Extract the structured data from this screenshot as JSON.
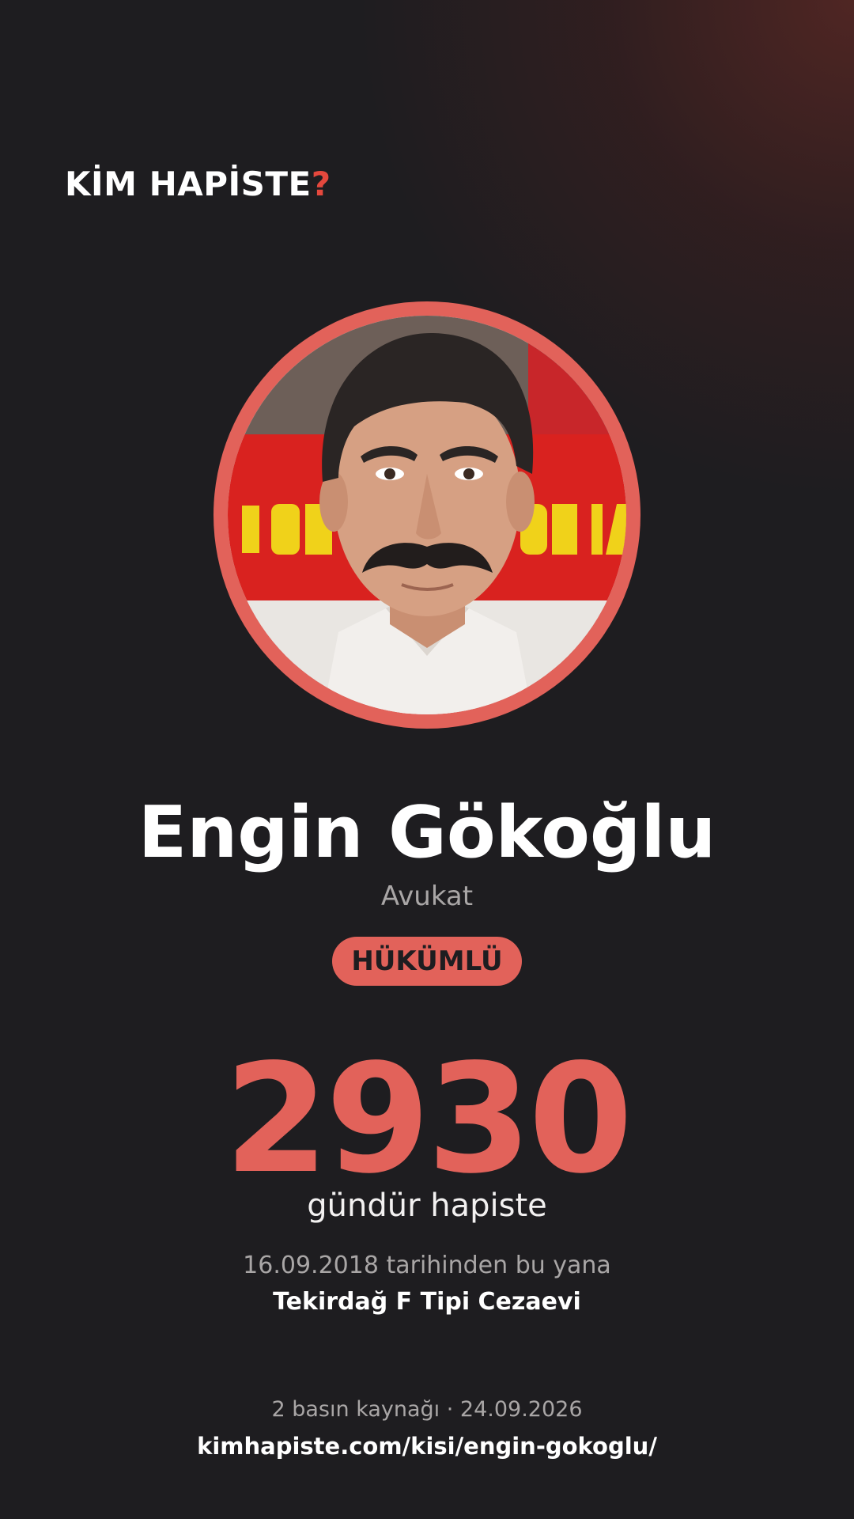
{
  "brand": {
    "logo_text": "KİM HAPİSTE",
    "logo_mark": "?",
    "accent_color": "#e2625a"
  },
  "profile": {
    "photo": "portrait-photo",
    "name": "Engin Gökoğlu",
    "occupation": "Avukat",
    "status": "HÜKÜMLÜ"
  },
  "detention": {
    "days": "2930",
    "days_label": "gündür hapiste",
    "since_text": "16.09.2018 tarihinden bu yana",
    "prison": "Tekirdağ F Tipi Cezaevi"
  },
  "footer": {
    "sources_text": "2 basın kaynağı · 24.09.2026",
    "url": "kimhapiste.com/kisi/engin-gokoglu/"
  },
  "colors": {
    "background": "#1e1d20",
    "accent": "#e2625a",
    "muted_text": "#a9a6a6"
  }
}
